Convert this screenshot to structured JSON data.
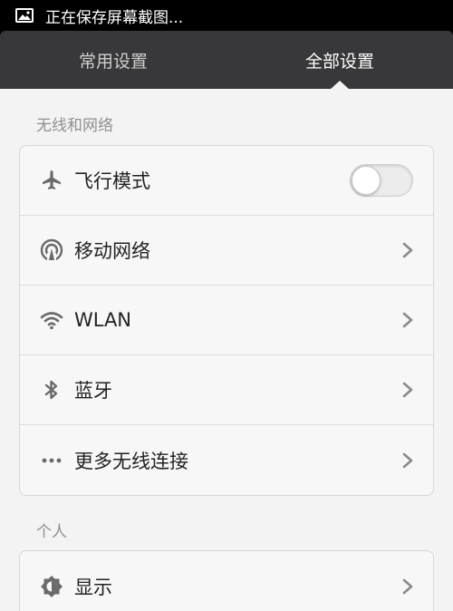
{
  "status_bar": {
    "text": "正在保存屏幕截图..."
  },
  "tabs": [
    {
      "label": "常用设置",
      "active": false
    },
    {
      "label": "全部设置",
      "active": true
    }
  ],
  "sections": {
    "wireless": {
      "title": "无线和网络",
      "items": [
        {
          "label": "飞行模式",
          "icon": "airplane-icon",
          "control": "toggle",
          "value": "off"
        },
        {
          "label": "移动网络",
          "icon": "mobile-network-icon",
          "control": "chevron"
        },
        {
          "label": "WLAN",
          "icon": "wifi-icon",
          "control": "chevron"
        },
        {
          "label": "蓝牙",
          "icon": "bluetooth-icon",
          "control": "chevron"
        },
        {
          "label": "更多无线连接",
          "icon": "more-dots-icon",
          "control": "chevron"
        }
      ]
    },
    "personal": {
      "title": "个人",
      "items": [
        {
          "label": "显示",
          "icon": "brightness-icon",
          "control": "chevron"
        }
      ]
    }
  },
  "colors": {
    "status_bar_bg": "#000000",
    "tab_bar_bg": "#38383a",
    "page_bg": "#f3f3f3",
    "icon_gray": "#6a6a6a"
  }
}
